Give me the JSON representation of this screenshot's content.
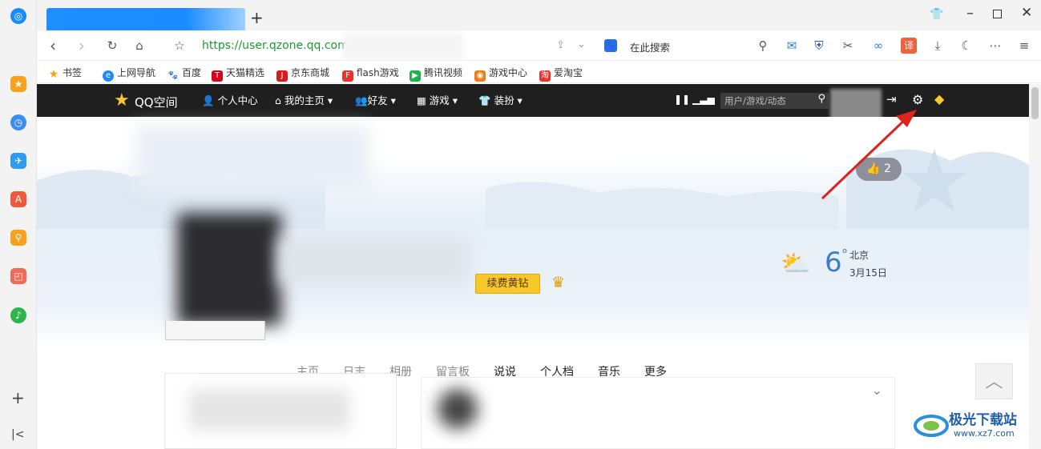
{
  "browser": {
    "url": "https://user.qzone.qq.com/",
    "search_placeholder": "在此搜索",
    "new_tab_symbol": "+"
  },
  "bookmarks": [
    {
      "label": "书签"
    },
    {
      "label": "上网导航"
    },
    {
      "label": "百度"
    },
    {
      "label": "天猫精选"
    },
    {
      "label": "京东商城"
    },
    {
      "label": "flash游戏"
    },
    {
      "label": "腾讯视频"
    },
    {
      "label": "游戏中心"
    },
    {
      "label": "爱淘宝"
    }
  ],
  "qzone": {
    "logo": "QQ空间",
    "nav": [
      "个人中心",
      "我的主页",
      "好友",
      "游戏",
      "装扮"
    ],
    "search_placeholder": "用户/游戏/动态",
    "like_count": "2",
    "renew_button": "续费黄钻",
    "weather": {
      "temp": "6",
      "unit": "°",
      "city": "北京",
      "date": "3月15日"
    },
    "tabs": [
      "主页",
      "日志",
      "相册",
      "留言板",
      "说说",
      "个人档",
      "音乐",
      "更多"
    ]
  },
  "watermark": {
    "title": "极光下载站",
    "url": "www.xz7.com"
  },
  "colors": {
    "accent": "#1a8cff",
    "qzone_bar": "#1f1f1f",
    "gold": "#f8c72a",
    "arrow": "#d9251d"
  }
}
